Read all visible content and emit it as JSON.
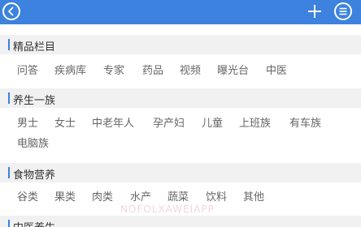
{
  "icons": {
    "back": "circle-chevron-left-icon",
    "add": "plus-icon",
    "menu": "circle-menu-icon"
  },
  "colors": {
    "header": "#3c82de",
    "section_bg": "#f1f1f1",
    "accent_bar": "#3c82de"
  },
  "sections": [
    {
      "title": "精品栏目",
      "tags": [
        "问答",
        "疾病库",
        "专家",
        "药品",
        "视频",
        "曝光台",
        "中医"
      ]
    },
    {
      "title": "养生一族",
      "tags": [
        "男士",
        "女士",
        "中老年人",
        "孕产妇",
        "儿童",
        "上班族",
        "有车族",
        "电脑族"
      ]
    },
    {
      "title": "食物营养",
      "tags": [
        "谷类",
        "果类",
        "肉类",
        "水产",
        "蔬菜",
        "饮料",
        "其他"
      ]
    },
    {
      "title": "中医养生"
    }
  ],
  "watermark": "NOFOLXAWEIAPP"
}
